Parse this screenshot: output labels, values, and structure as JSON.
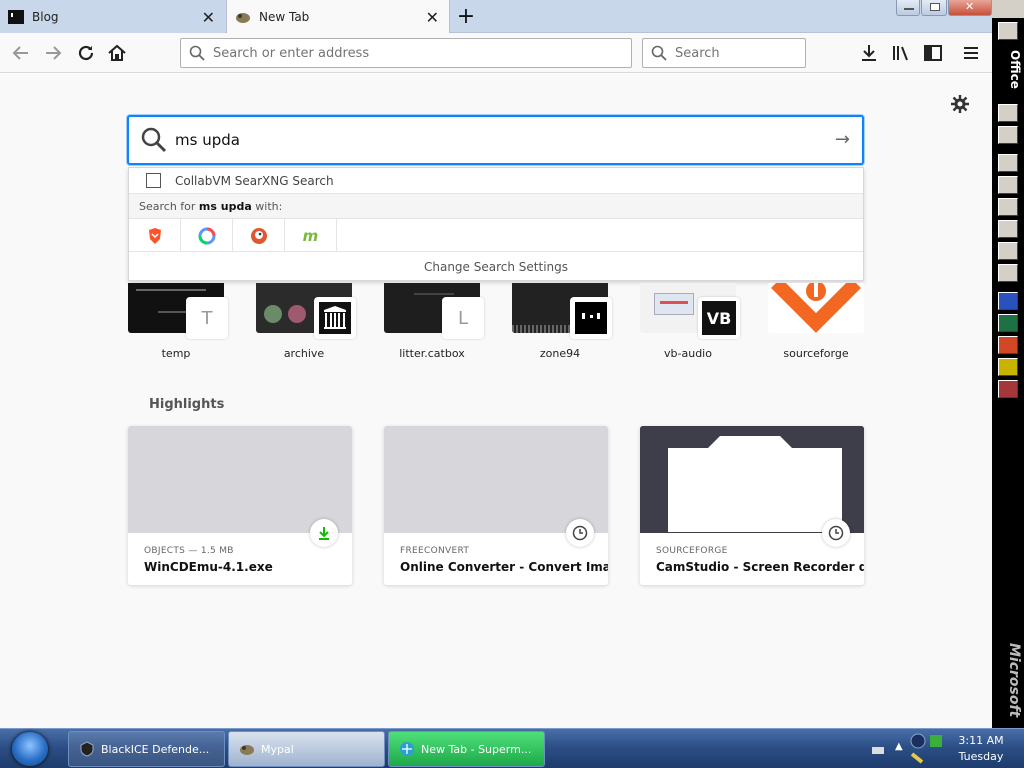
{
  "tabs": [
    {
      "title": "Blog",
      "active": false
    },
    {
      "title": "New Tab",
      "active": true
    }
  ],
  "nav": {
    "url_placeholder": "Search or enter address",
    "search_placeholder": "Search"
  },
  "search": {
    "query": "ms upda",
    "suggestion_label": "CollabVM SearXNG Search",
    "search_for_prefix": "Search for ",
    "search_for_query": "ms upda",
    "search_for_suffix": " with:",
    "engines": [
      "brave-icon",
      "qwant-icon",
      "duckduckgo-icon",
      "mojeek-icon"
    ],
    "change_settings": "Change Search Settings"
  },
  "top_sites": [
    {
      "name": "temp",
      "letter": "T"
    },
    {
      "name": "archive",
      "letter": ""
    },
    {
      "name": "litter.catbox",
      "letter": "L"
    },
    {
      "name": "zone94",
      "letter": ""
    },
    {
      "name": "vb-audio",
      "letter": "VB"
    },
    {
      "name": "sourceforge",
      "letter": ""
    }
  ],
  "highlights": {
    "title": "Highlights",
    "cards": [
      {
        "source": "OBJECTS — 1.5 MB",
        "title": "WinCDEmu-4.1.exe",
        "badge": "download-icon"
      },
      {
        "source": "FREECONVERT",
        "title": "Online Converter - Convert Ima...",
        "badge": "clock-icon"
      },
      {
        "source": "SOURCEFORGE",
        "title": "CamStudio - Screen Recorder d...",
        "badge": "clock-icon"
      }
    ]
  },
  "officebar": {
    "label": "Office",
    "brand": "Microsoft"
  },
  "taskbar": {
    "items": [
      {
        "label": "BlackICE Defende..."
      },
      {
        "label": "Mypal"
      },
      {
        "label": "New Tab - Superm..."
      }
    ],
    "time": "3:11 AM",
    "day": "Tuesday"
  },
  "colors": {
    "accent": "#0a84ff",
    "download": "#12bc00",
    "taskbar": "#2c4f86"
  }
}
